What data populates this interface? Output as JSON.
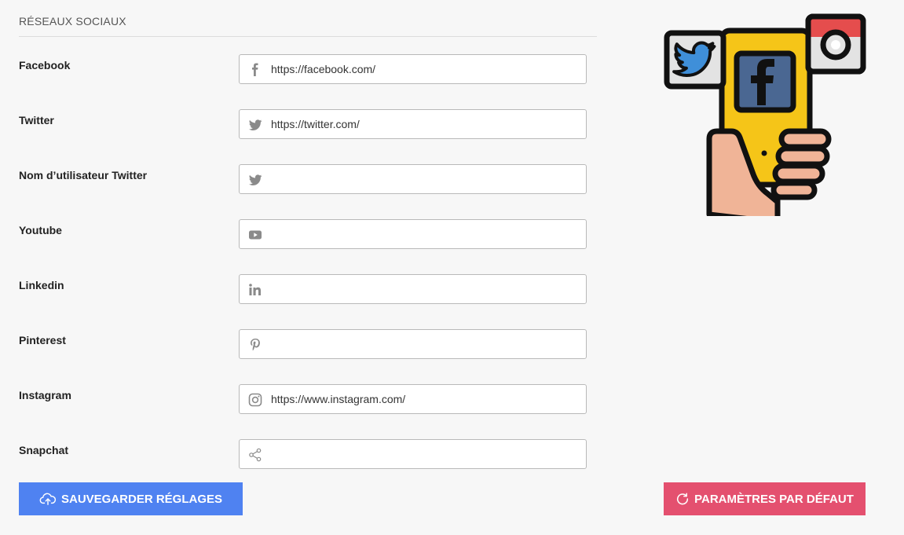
{
  "section": {
    "title": "RÉSEAUX SOCIAUX"
  },
  "fields": [
    {
      "label": "Facebook",
      "icon": "facebook-icon",
      "value": "https://facebook.com/"
    },
    {
      "label": "Twitter",
      "icon": "twitter-icon",
      "value": "https://twitter.com/"
    },
    {
      "label": "Nom d’utilisateur Twitter",
      "icon": "twitter-icon",
      "value": ""
    },
    {
      "label": "Youtube",
      "icon": "youtube-icon",
      "value": ""
    },
    {
      "label": "Linkedin",
      "icon": "linkedin-icon",
      "value": ""
    },
    {
      "label": "Pinterest",
      "icon": "pinterest-icon",
      "value": ""
    },
    {
      "label": "Instagram",
      "icon": "instagram-icon",
      "value": "https://www.instagram.com/"
    },
    {
      "label": "Snapchat",
      "icon": "share-icon",
      "value": ""
    }
  ],
  "buttons": {
    "save_label": "SAUVEGARDER RÉGLAGES",
    "reset_label": "PARAMÈTRES PAR DÉFAUT"
  },
  "colors": {
    "save": "#4f82f1",
    "reset": "#e4506f",
    "phone": "#f5c518",
    "facebook": "#4a6792",
    "twitter_bird": "#3f8fd9",
    "instagram_red": "#e54d4d"
  }
}
